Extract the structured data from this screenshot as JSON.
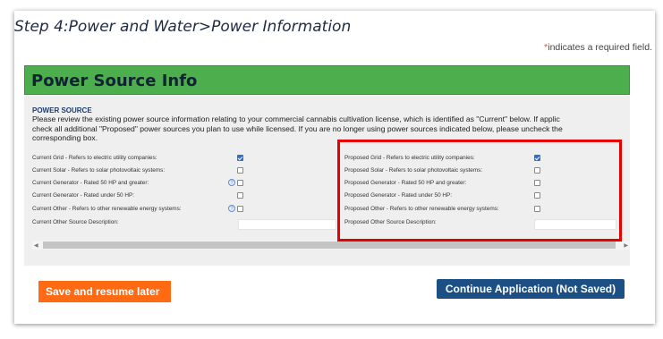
{
  "page": {
    "step_title": "Step 4:Power and Water>Power Information",
    "required_star": "*",
    "required_text": "indicates a required field."
  },
  "panel": {
    "title": "Power Source Info",
    "section_label": "POWER SOURCE",
    "description": "Please review the existing power source information relating to your commercial cannabis cultivation license, which is identified as \"Current\" below. If applic\ncheck all additional \"Proposed\" power sources you plan to use while licensed. If you are no longer using power sources indicated below, please uncheck the\ncorresponding box."
  },
  "current": [
    {
      "label": "Current Grid - Refers to electric utility companies:",
      "checked": true,
      "help": false
    },
    {
      "label": "Current Solar - Refers to solar photovoltaic systems:",
      "checked": false,
      "help": false
    },
    {
      "label": "Current Generator - Rated 50 HP and greater:",
      "checked": false,
      "help": true
    },
    {
      "label": "Current Generator - Rated under 50 HP:",
      "checked": false,
      "help": false
    },
    {
      "label": "Current Other - Refers to other renewable energy systems:",
      "checked": false,
      "help": true
    },
    {
      "label": "Current Other Source Description:"
    }
  ],
  "proposed": [
    {
      "label": "Proposed Grid - Refers to electric utility companies:",
      "checked": true
    },
    {
      "label": "Proposed Solar - Refers to solar photovoltaic systems:",
      "checked": false
    },
    {
      "label": "Proposed Generator - Rated 50 HP and greater:",
      "checked": false
    },
    {
      "label": "Proposed Generator - Rated under 50 HP:",
      "checked": false
    },
    {
      "label": "Proposed Other - Refers to other renewable energy systems:",
      "checked": false
    },
    {
      "label": "Proposed Other Source Description:"
    }
  ],
  "help_glyph": "?",
  "buttons": {
    "save": "Save and resume later",
    "continue": "Continue Application (Not Saved)"
  },
  "colors": {
    "header_green": "#4cae4c",
    "save_orange": "#ff6a13",
    "continue_blue": "#1c4f84",
    "highlight_red": "#e60000"
  }
}
